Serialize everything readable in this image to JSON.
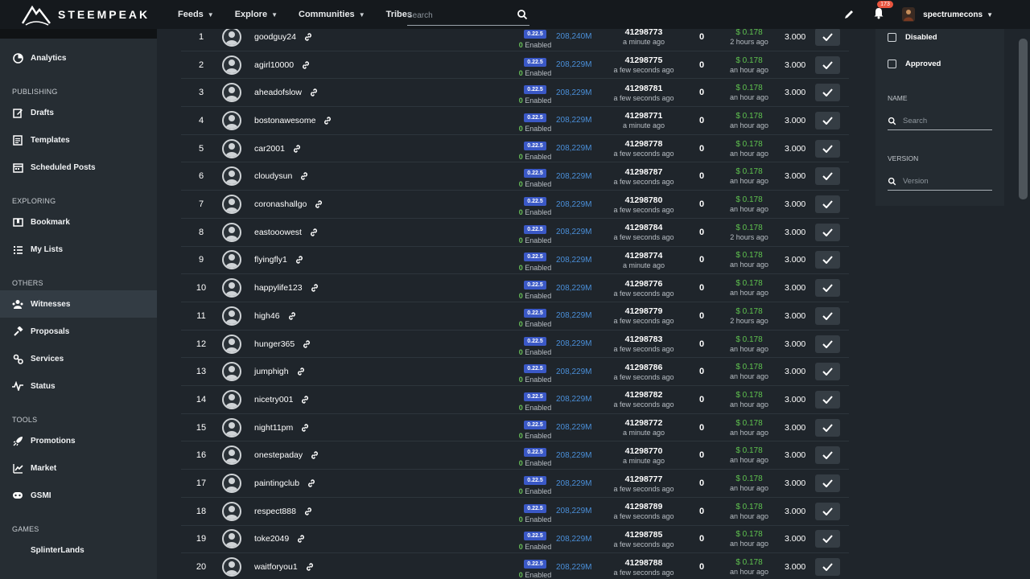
{
  "app": {
    "name": "STEEMPEAK"
  },
  "topnav": {
    "items": [
      {
        "label": "Feeds",
        "has_dropdown": true
      },
      {
        "label": "Explore",
        "has_dropdown": true
      },
      {
        "label": "Communities",
        "has_dropdown": true
      },
      {
        "label": "Tribes",
        "has_dropdown": false
      }
    ],
    "search_placeholder": "Search",
    "notification_count": "173",
    "username": "spectrumecons"
  },
  "sidebar": {
    "top_item": {
      "label": "Analytics",
      "icon": "analytics-icon"
    },
    "sections": [
      {
        "title": "PUBLISHING",
        "items": [
          {
            "label": "Drafts",
            "icon": "drafts-icon"
          },
          {
            "label": "Templates",
            "icon": "templates-icon"
          },
          {
            "label": "Scheduled Posts",
            "icon": "calendar-icon"
          }
        ]
      },
      {
        "title": "EXPLORING",
        "items": [
          {
            "label": "Bookmark",
            "icon": "bookmark-icon"
          },
          {
            "label": "My Lists",
            "icon": "list-icon"
          }
        ]
      },
      {
        "title": "OTHERS",
        "items": [
          {
            "label": "Witnesses",
            "icon": "witness-icon",
            "active": true
          },
          {
            "label": "Proposals",
            "icon": "proposals-icon"
          },
          {
            "label": "Services",
            "icon": "services-icon"
          },
          {
            "label": "Status",
            "icon": "status-icon"
          }
        ]
      },
      {
        "title": "TOOLS",
        "items": [
          {
            "label": "Promotions",
            "icon": "rocket-icon"
          },
          {
            "label": "Market",
            "icon": "market-icon"
          },
          {
            "label": "GSMI",
            "icon": "gsmi-icon"
          }
        ]
      },
      {
        "title": "GAMES",
        "items": [
          {
            "label": "SplinterLands",
            "icon": "game-icon"
          }
        ]
      }
    ]
  },
  "filters": {
    "disabled_label": "Disabled",
    "approved_label": "Approved",
    "name_label": "NAME",
    "name_placeholder": "Search",
    "version_label": "VERSION",
    "version_placeholder": "Version"
  },
  "witnesses": [
    {
      "rank": "1",
      "name": "goodguy24",
      "version": "0.22.5",
      "enabled_count": "0",
      "enabled_label": "Enabled",
      "votes": "208,240M",
      "block": "41298773",
      "block_time": "a minute ago",
      "missed": "0",
      "price": "$ 0.178",
      "price_time": "2 hours ago",
      "apr": "3.000"
    },
    {
      "rank": "2",
      "name": "agirl10000",
      "version": "0.22.5",
      "enabled_count": "0",
      "enabled_label": "Enabled",
      "votes": "208,229M",
      "block": "41298775",
      "block_time": "a few seconds ago",
      "missed": "0",
      "price": "$ 0.178",
      "price_time": "an hour ago",
      "apr": "3.000"
    },
    {
      "rank": "3",
      "name": "aheadofslow",
      "version": "0.22.5",
      "enabled_count": "0",
      "enabled_label": "Enabled",
      "votes": "208,229M",
      "block": "41298781",
      "block_time": "a few seconds ago",
      "missed": "0",
      "price": "$ 0.178",
      "price_time": "an hour ago",
      "apr": "3.000"
    },
    {
      "rank": "4",
      "name": "bostonawesome",
      "version": "0.22.5",
      "enabled_count": "0",
      "enabled_label": "Enabled",
      "votes": "208,229M",
      "block": "41298771",
      "block_time": "a minute ago",
      "missed": "0",
      "price": "$ 0.178",
      "price_time": "an hour ago",
      "apr": "3.000"
    },
    {
      "rank": "5",
      "name": "car2001",
      "version": "0.22.5",
      "enabled_count": "0",
      "enabled_label": "Enabled",
      "votes": "208,229M",
      "block": "41298778",
      "block_time": "a few seconds ago",
      "missed": "0",
      "price": "$ 0.178",
      "price_time": "an hour ago",
      "apr": "3.000"
    },
    {
      "rank": "6",
      "name": "cloudysun",
      "version": "0.22.5",
      "enabled_count": "0",
      "enabled_label": "Enabled",
      "votes": "208,229M",
      "block": "41298787",
      "block_time": "a few seconds ago",
      "missed": "0",
      "price": "$ 0.178",
      "price_time": "an hour ago",
      "apr": "3.000"
    },
    {
      "rank": "7",
      "name": "coronashallgo",
      "version": "0.22.5",
      "enabled_count": "0",
      "enabled_label": "Enabled",
      "votes": "208,229M",
      "block": "41298780",
      "block_time": "a few seconds ago",
      "missed": "0",
      "price": "$ 0.178",
      "price_time": "an hour ago",
      "apr": "3.000"
    },
    {
      "rank": "8",
      "name": "eastooowest",
      "version": "0.22.5",
      "enabled_count": "0",
      "enabled_label": "Enabled",
      "votes": "208,229M",
      "block": "41298784",
      "block_time": "a few seconds ago",
      "missed": "0",
      "price": "$ 0.178",
      "price_time": "2 hours ago",
      "apr": "3.000"
    },
    {
      "rank": "9",
      "name": "flyingfly1",
      "version": "0.22.5",
      "enabled_count": "0",
      "enabled_label": "Enabled",
      "votes": "208,229M",
      "block": "41298774",
      "block_time": "a minute ago",
      "missed": "0",
      "price": "$ 0.178",
      "price_time": "an hour ago",
      "apr": "3.000"
    },
    {
      "rank": "10",
      "name": "happylife123",
      "version": "0.22.5",
      "enabled_count": "0",
      "enabled_label": "Enabled",
      "votes": "208,229M",
      "block": "41298776",
      "block_time": "a few seconds ago",
      "missed": "0",
      "price": "$ 0.178",
      "price_time": "an hour ago",
      "apr": "3.000"
    },
    {
      "rank": "11",
      "name": "high46",
      "version": "0.22.5",
      "enabled_count": "0",
      "enabled_label": "Enabled",
      "votes": "208,229M",
      "block": "41298779",
      "block_time": "a few seconds ago",
      "missed": "0",
      "price": "$ 0.178",
      "price_time": "2 hours ago",
      "apr": "3.000"
    },
    {
      "rank": "12",
      "name": "hunger365",
      "version": "0.22.5",
      "enabled_count": "0",
      "enabled_label": "Enabled",
      "votes": "208,229M",
      "block": "41298783",
      "block_time": "a few seconds ago",
      "missed": "0",
      "price": "$ 0.178",
      "price_time": "an hour ago",
      "apr": "3.000"
    },
    {
      "rank": "13",
      "name": "jumphigh",
      "version": "0.22.5",
      "enabled_count": "0",
      "enabled_label": "Enabled",
      "votes": "208,229M",
      "block": "41298786",
      "block_time": "a few seconds ago",
      "missed": "0",
      "price": "$ 0.178",
      "price_time": "an hour ago",
      "apr": "3.000"
    },
    {
      "rank": "14",
      "name": "nicetry001",
      "version": "0.22.5",
      "enabled_count": "0",
      "enabled_label": "Enabled",
      "votes": "208,229M",
      "block": "41298782",
      "block_time": "a few seconds ago",
      "missed": "0",
      "price": "$ 0.178",
      "price_time": "an hour ago",
      "apr": "3.000"
    },
    {
      "rank": "15",
      "name": "night11pm",
      "version": "0.22.5",
      "enabled_count": "0",
      "enabled_label": "Enabled",
      "votes": "208,229M",
      "block": "41298772",
      "block_time": "a minute ago",
      "missed": "0",
      "price": "$ 0.178",
      "price_time": "an hour ago",
      "apr": "3.000"
    },
    {
      "rank": "16",
      "name": "onestepaday",
      "version": "0.22.5",
      "enabled_count": "0",
      "enabled_label": "Enabled",
      "votes": "208,229M",
      "block": "41298770",
      "block_time": "a minute ago",
      "missed": "0",
      "price": "$ 0.178",
      "price_time": "an hour ago",
      "apr": "3.000"
    },
    {
      "rank": "17",
      "name": "paintingclub",
      "version": "0.22.5",
      "enabled_count": "0",
      "enabled_label": "Enabled",
      "votes": "208,229M",
      "block": "41298777",
      "block_time": "a few seconds ago",
      "missed": "0",
      "price": "$ 0.178",
      "price_time": "an hour ago",
      "apr": "3.000"
    },
    {
      "rank": "18",
      "name": "respect888",
      "version": "0.22.5",
      "enabled_count": "0",
      "enabled_label": "Enabled",
      "votes": "208,229M",
      "block": "41298789",
      "block_time": "a few seconds ago",
      "missed": "0",
      "price": "$ 0.178",
      "price_time": "an hour ago",
      "apr": "3.000"
    },
    {
      "rank": "19",
      "name": "toke2049",
      "version": "0.22.5",
      "enabled_count": "0",
      "enabled_label": "Enabled",
      "votes": "208,229M",
      "block": "41298785",
      "block_time": "a few seconds ago",
      "missed": "0",
      "price": "$ 0.178",
      "price_time": "an hour ago",
      "apr": "3.000"
    },
    {
      "rank": "20",
      "name": "waitforyou1",
      "version": "0.22.5",
      "enabled_count": "0",
      "enabled_label": "Enabled",
      "votes": "208,229M",
      "block": "41298788",
      "block_time": "a few seconds ago",
      "missed": "0",
      "price": "$ 0.178",
      "price_time": "an hour ago",
      "apr": "3.000"
    }
  ],
  "colors": {
    "accent_blue": "#3a58c6",
    "vote_blue": "#4a8fd9",
    "price_green": "#5fc24f",
    "badge_red": "#e8543e"
  }
}
